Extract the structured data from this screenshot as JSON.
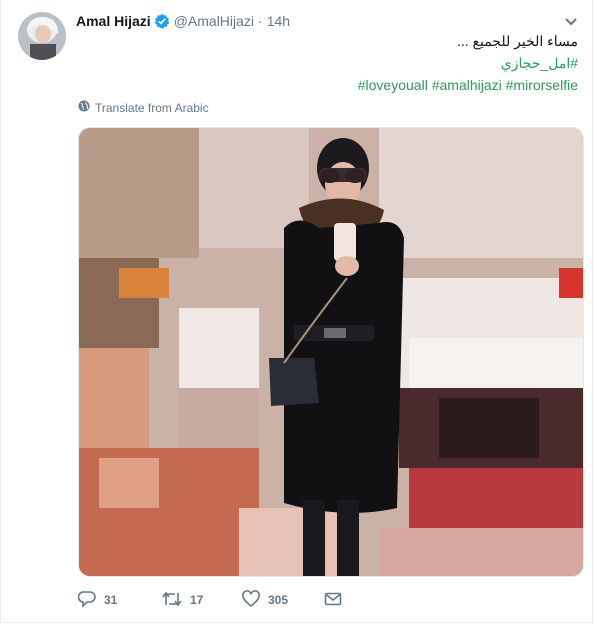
{
  "tweet": {
    "name": "Amal Hijazi",
    "handle": "@AmalHijazi",
    "separator": "·",
    "time": "14h",
    "text_line1": "مساء الخير للجميع ...",
    "hashtag_arabic": "#امل_حجازي",
    "hashtags": [
      "#loveyouall",
      "#amalhijazi",
      "#mirorselfie"
    ],
    "translate_label": "Translate from Arabic"
  },
  "actions": {
    "reply_count": "31",
    "retweet_count": "17",
    "like_count": "305"
  },
  "colors": {
    "link": "#1b95e0",
    "hashtag_green": "#2a9d57",
    "muted": "#657786",
    "verified": "#1da1f2"
  }
}
